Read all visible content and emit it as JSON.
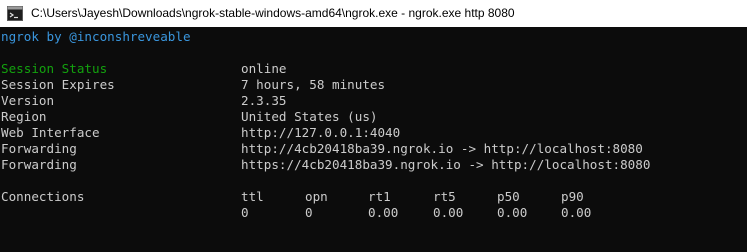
{
  "window": {
    "title": "C:\\Users\\Jayesh\\Downloads\\ngrok-stable-windows-amd64\\ngrok.exe - ngrok.exe  http 8080",
    "icon": "terminal-icon"
  },
  "banner": "ngrok by @inconshreveable",
  "status_rows": [
    {
      "label": "Session Status",
      "value": "online"
    },
    {
      "label": "Session Expires",
      "value": "7 hours, 58 minutes"
    },
    {
      "label": "Version",
      "value": "2.3.35"
    },
    {
      "label": "Region",
      "value": "United States (us)"
    },
    {
      "label": "Web Interface",
      "value": "http://127.0.0.1:4040"
    },
    {
      "label": "Forwarding",
      "value": "http://4cb20418ba39.ngrok.io -> http://localhost:8080"
    },
    {
      "label": "Forwarding",
      "value": "https://4cb20418ba39.ngrok.io -> http://localhost:8080"
    }
  ],
  "connections": {
    "label": "Connections",
    "headers": [
      "ttl",
      "opn",
      "rt1",
      "rt5",
      "p50",
      "p90"
    ],
    "values": [
      "0",
      "0",
      "0.00",
      "0.00",
      "0.00",
      "0.00"
    ]
  },
  "colors": {
    "background": "#0c0c0c",
    "text": "#cccccc",
    "online_green": "#13a10e",
    "banner_blue": "#3a96dd"
  }
}
